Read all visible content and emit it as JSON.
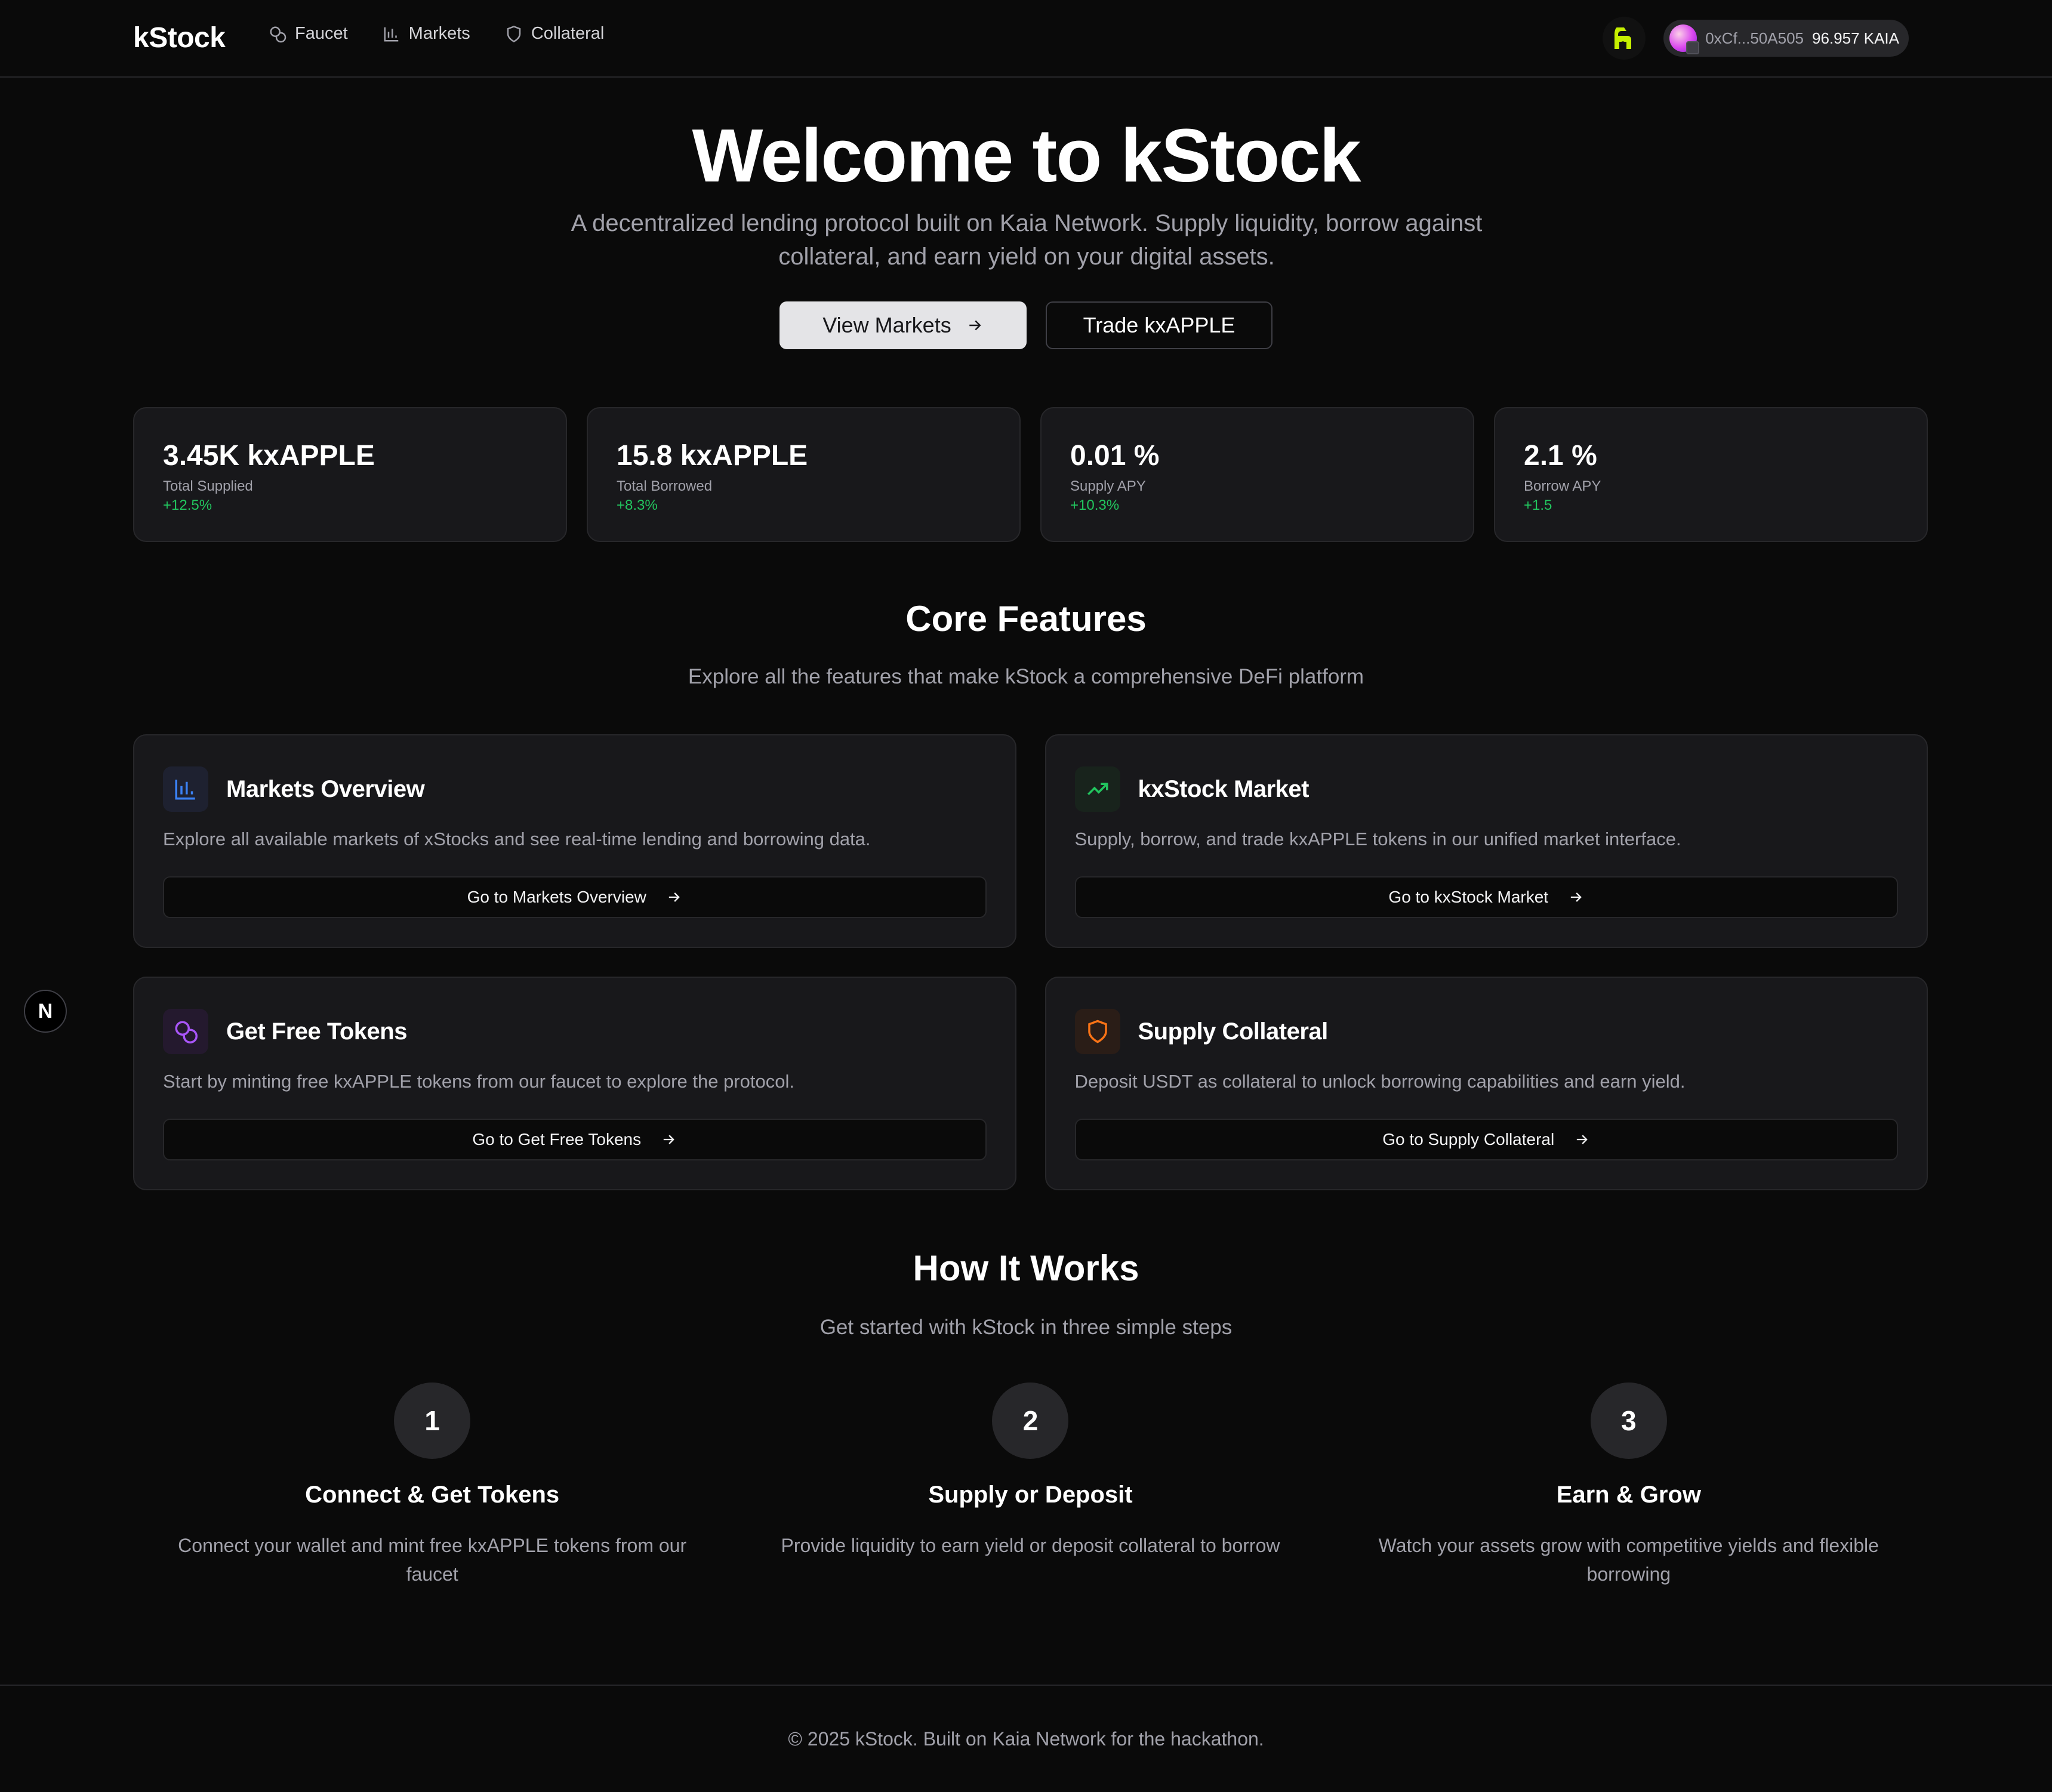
{
  "nav": {
    "brand": "kStock",
    "links": [
      {
        "label": "Faucet",
        "icon": "coins-icon"
      },
      {
        "label": "Markets",
        "icon": "bar-chart-icon"
      },
      {
        "label": "Collateral",
        "icon": "shield-icon"
      }
    ],
    "wallet": {
      "address": "0xCf...50A505",
      "balance": "96.957 KAIA"
    }
  },
  "hero": {
    "title": "Welcome to kStock",
    "subtitle": "A decentralized lending protocol built on Kaia Network. Supply liquidity, borrow against collateral, and earn yield on your digital assets.",
    "primary_button": "View Markets",
    "secondary_button": "Trade kxAPPLE"
  },
  "stats": [
    {
      "value": "3.45K kxAPPLE",
      "label": "Total Supplied",
      "delta": "+12.5%"
    },
    {
      "value": "15.8 kxAPPLE",
      "label": "Total Borrowed",
      "delta": "+8.3%"
    },
    {
      "value": "0.01 %",
      "label": "Supply APY",
      "delta": "+10.3%"
    },
    {
      "value": "2.1 %",
      "label": "Borrow APY",
      "delta": "+1.5"
    }
  ],
  "features_section": {
    "title": "Core Features",
    "subtitle": "Explore all the features that make kStock a comprehensive DeFi platform",
    "items": [
      {
        "title": "Markets Overview",
        "desc": "Explore all available markets of xStocks and see real-time lending and borrowing data.",
        "button": "Go to Markets Overview",
        "icon": "bar-chart-icon",
        "color": "#3b82f6"
      },
      {
        "title": "kxStock Market",
        "desc": "Supply, borrow, and trade kxAPPLE tokens in our unified market interface.",
        "button": "Go to kxStock Market",
        "icon": "trending-up-icon",
        "color": "#22c55e"
      },
      {
        "title": "Get Free Tokens",
        "desc": "Start by minting free kxAPPLE tokens from our faucet to explore the protocol.",
        "button": "Go to Get Free Tokens",
        "icon": "coins-icon",
        "color": "#a855f7"
      },
      {
        "title": "Supply Collateral",
        "desc": "Deposit USDT as collateral to unlock borrowing capabilities and earn yield.",
        "button": "Go to Supply Collateral",
        "icon": "shield-icon",
        "color": "#f97316"
      }
    ]
  },
  "how_section": {
    "title": "How It Works",
    "subtitle": "Get started with kStock in three simple steps",
    "steps": [
      {
        "num": "1",
        "title": "Connect & Get Tokens",
        "desc": "Connect your wallet and mint free kxAPPLE tokens from our faucet"
      },
      {
        "num": "2",
        "title": "Supply or Deposit",
        "desc": "Provide liquidity to earn yield or deposit collateral to borrow"
      },
      {
        "num": "3",
        "title": "Earn & Grow",
        "desc": "Watch your assets grow with competitive yields and flexible borrowing"
      }
    ]
  },
  "footer": {
    "text": "© 2025 kStock. Built on Kaia Network for the hackathon."
  },
  "badge": {
    "letter": "N"
  }
}
